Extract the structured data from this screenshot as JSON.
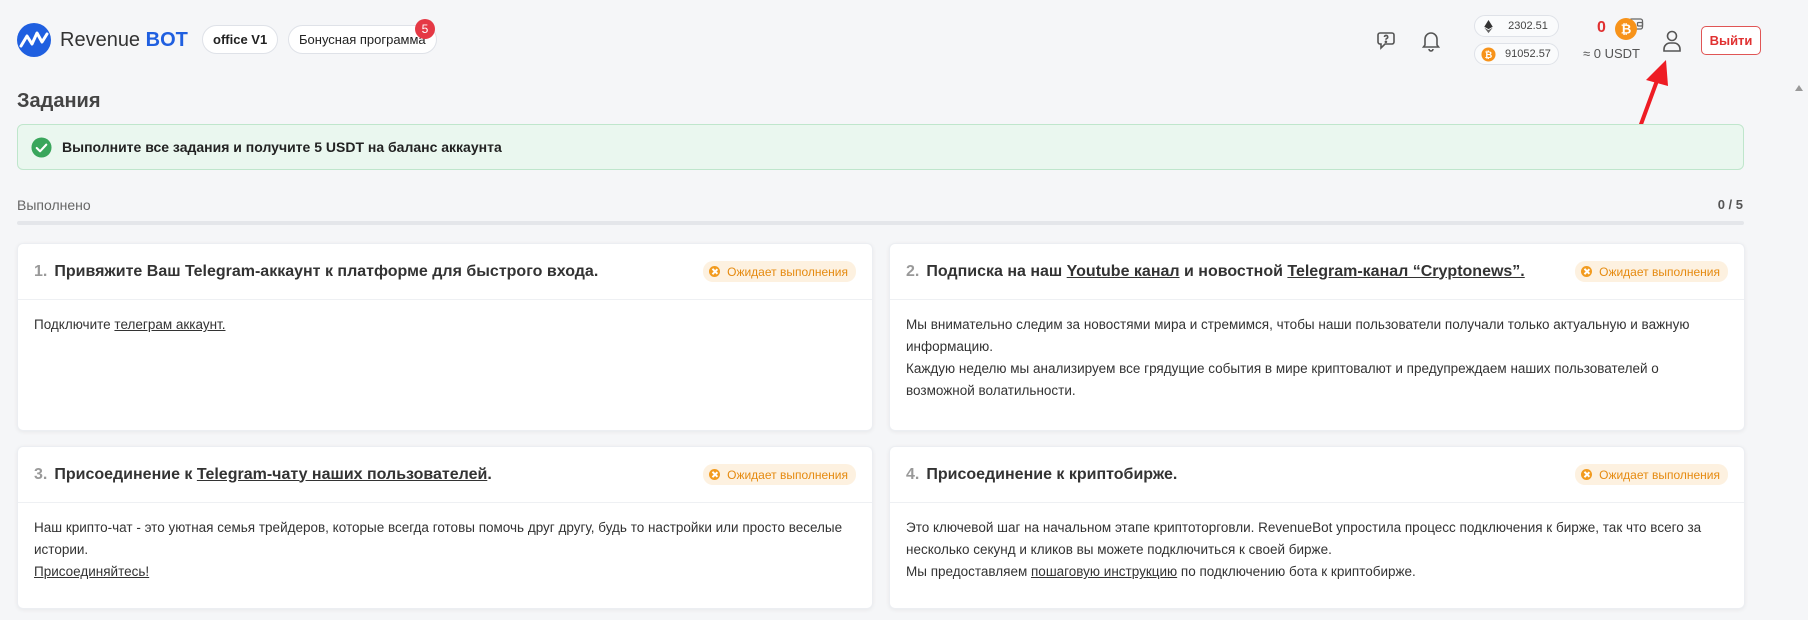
{
  "header": {
    "logo_text_a": "Revenue",
    "logo_text_b": "BOT",
    "office_label": "office V1",
    "bonus_label": "Бонусная программа",
    "bonus_count": "5",
    "eth_price": "2302.51",
    "btc_price": "91052.57",
    "balance_value": "0",
    "balance_usdt": "≈ 0 USDT",
    "logout_label": "Выйти"
  },
  "page": {
    "title": "Задания",
    "alert_text": "Выполните все задания и получите 5 USDT на баланс аккаунта",
    "progress_label": "Выполнено",
    "progress_count": "0 / 5",
    "progress_fraction": 0
  },
  "tasks": [
    {
      "num": "1.",
      "title_a": "Привяжите Ваш Telegram-аккаунт к платформе для быстрого входа.",
      "status": "Ожидает выполнения",
      "body_a": "Подключите ",
      "body_link": "телеграм аккаунт."
    },
    {
      "num": "2.",
      "title_a": "Подписка на наш ",
      "title_link1": "Youtube канал",
      "title_b": " и новостной ",
      "title_link2": "Telegram-канал “Cryptonews”.",
      "status": "Ожидает выполнения",
      "body_line1": "Мы внимательно следим за новостями мира и стремимся, чтобы наши пользователи получали только актуальную и важную информацию.",
      "body_line2": "Каждую неделю мы анализируем все грядущие события в мире криптовалют и предупреждаем наших пользователей о возможной волатильности."
    },
    {
      "num": "3.",
      "title_a": "Присоединение к ",
      "title_link": "Telegram-чату наших пользователей",
      "title_b": ".",
      "status": "Ожидает выполнения",
      "body_line1": "Наш крипто-чат - это уютная семья трейдеров, которые всегда готовы помочь друг другу, будь то настройки или просто веселые истории.",
      "body_link": "Присоединяйтесь!"
    },
    {
      "num": "4.",
      "title_a": "Присоединение к криптобирже.",
      "status": "Ожидает выполнения",
      "body_line1": "Это ключевой шаг на начальном этапе криптоторговли. RevenueBot упростила процесс подключения к бирже, так что всего за несколько секунд и кликов вы можете подключиться к своей бирже.",
      "body_line2_a": "Мы предоставляем ",
      "body_line2_link": "пошаговую инструкцию",
      "body_line2_b": " по подключению бота к криптобирже."
    }
  ],
  "colors": {
    "brand": "#1f5fe0",
    "danger": "#e03131",
    "success": "#3aa65c",
    "pending": "#e58a10"
  }
}
